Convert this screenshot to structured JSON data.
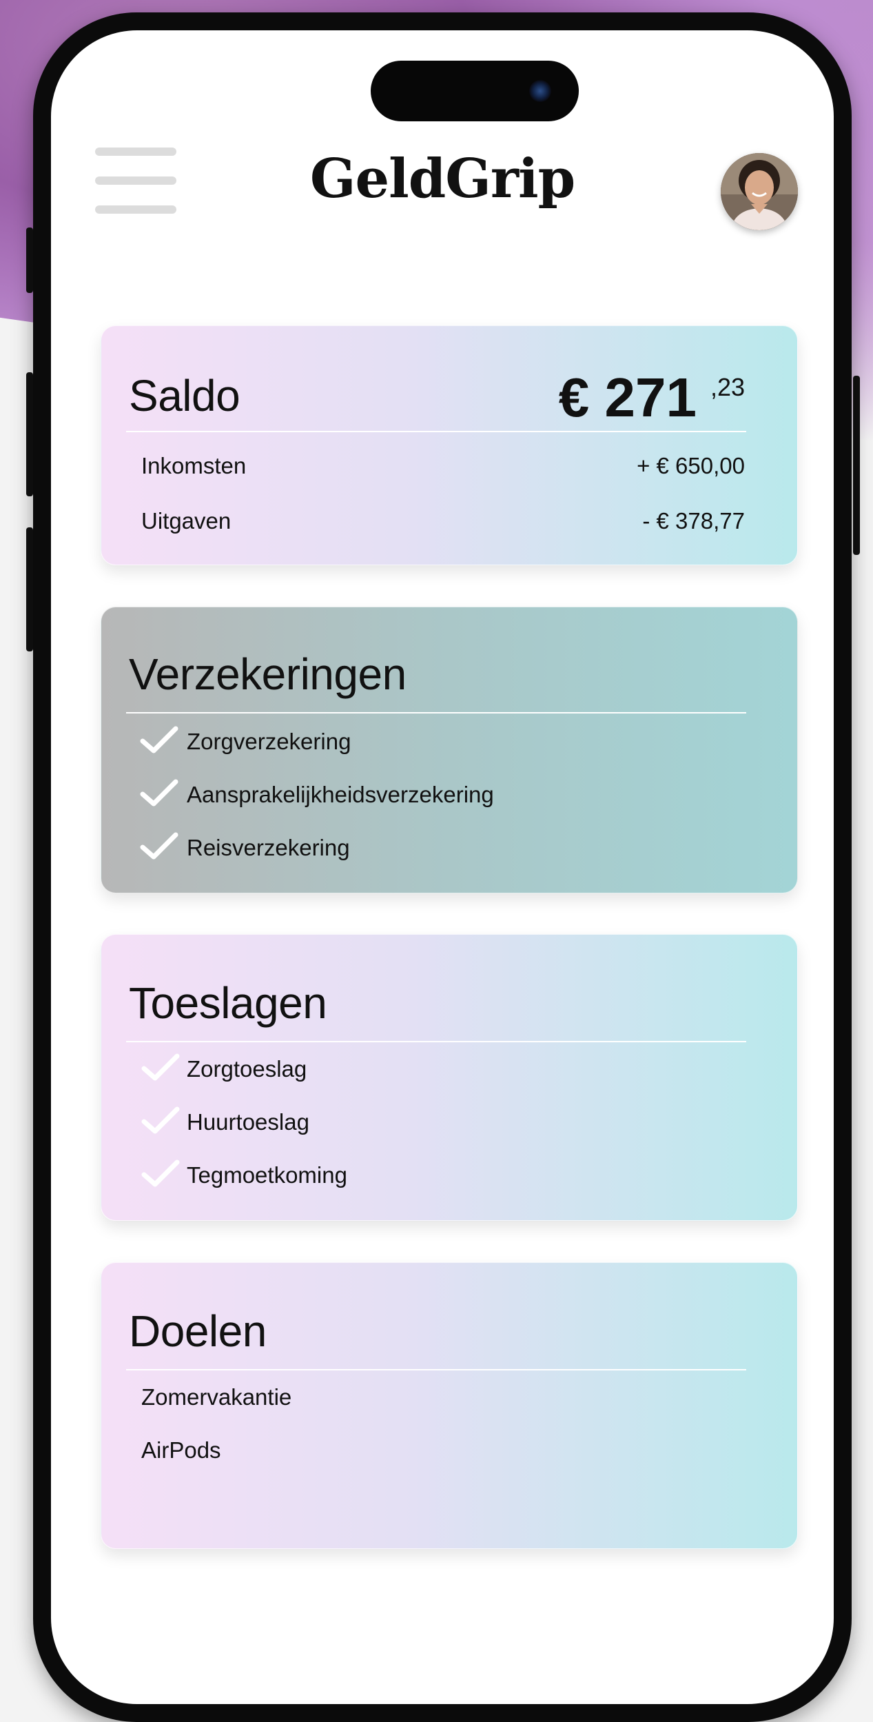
{
  "app": {
    "title": "GeldGrip"
  },
  "header": {
    "menu_icon": "hamburger-icon",
    "avatar_icon": "user-avatar"
  },
  "balance": {
    "title": "Saldo",
    "amount_main": "€ 271",
    "amount_cents": ",23",
    "rows": [
      {
        "label": "Inkomsten",
        "value": "+ € 650,00"
      },
      {
        "label": "Uitgaven",
        "value": "- € 378,77"
      }
    ]
  },
  "insurances": {
    "title": "Verzekeringen",
    "items": [
      "Zorgverzekering",
      "Aansprakelijkheidsverzekering",
      "Reisverzekering"
    ]
  },
  "allowances": {
    "title": "Toeslagen",
    "items": [
      "Zorgtoeslag",
      "Huurtoeslag",
      "Tegmoetkoming"
    ]
  },
  "goals": {
    "title": "Doelen",
    "items": [
      "Zomervakantie",
      "AirPods"
    ]
  },
  "colors": {
    "card_gradient": [
      "#f5e0f7",
      "#e3e0f4",
      "#b9e9ec"
    ],
    "grey_card_gradient": [
      "#b7b7b7",
      "#aac7c8",
      "#a3d4d6"
    ],
    "background_accent": "#b98bc6"
  }
}
